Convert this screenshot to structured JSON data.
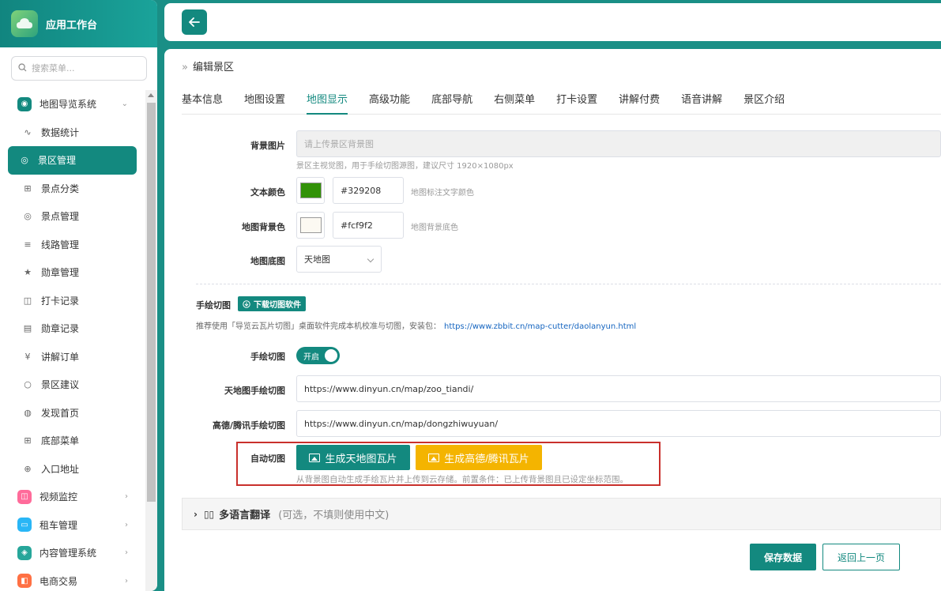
{
  "app": {
    "title": "应用工作台"
  },
  "search": {
    "placeholder": "搜索菜单..."
  },
  "sidebar": {
    "items": [
      {
        "label": "地图导览系统",
        "icon": "map-pin-icon",
        "type": "parent",
        "color": "#13897f",
        "expanded": true
      },
      {
        "label": "数据统计",
        "icon": "pulse-icon",
        "type": "child"
      },
      {
        "label": "景区管理",
        "icon": "location-icon",
        "type": "child",
        "active": true
      },
      {
        "label": "景点分类",
        "icon": "grid-plus-icon",
        "type": "child"
      },
      {
        "label": "景点管理",
        "icon": "location-icon",
        "type": "child"
      },
      {
        "label": "线路管理",
        "icon": "sliders-icon",
        "type": "child"
      },
      {
        "label": "勋章管理",
        "icon": "star-icon",
        "type": "child"
      },
      {
        "label": "打卡记录",
        "icon": "camera-icon",
        "type": "child"
      },
      {
        "label": "勋章记录",
        "icon": "list-icon",
        "type": "child"
      },
      {
        "label": "讲解订单",
        "icon": "yen-icon",
        "type": "child"
      },
      {
        "label": "景区建议",
        "icon": "circle-icon",
        "type": "child"
      },
      {
        "label": "发现首页",
        "icon": "palette-icon",
        "type": "child"
      },
      {
        "label": "底部菜单",
        "icon": "grid-plus-icon",
        "type": "child"
      },
      {
        "label": "入口地址",
        "icon": "globe-icon",
        "type": "child"
      },
      {
        "label": "视频监控",
        "icon": "camera-icon",
        "type": "parent",
        "color": "#ff6b9a"
      },
      {
        "label": "租车管理",
        "icon": "car-icon",
        "type": "parent",
        "color": "#29b6f6"
      },
      {
        "label": "内容管理系统",
        "icon": "layers-icon",
        "type": "parent",
        "color": "#26a69a"
      },
      {
        "label": "电商交易",
        "icon": "cart-icon",
        "type": "parent",
        "color": "#ff7043"
      }
    ]
  },
  "breadcrumb": {
    "current": "编辑景区"
  },
  "tabs": [
    {
      "label": "基本信息"
    },
    {
      "label": "地图设置"
    },
    {
      "label": "地图显示",
      "active": true
    },
    {
      "label": "高级功能"
    },
    {
      "label": "底部导航"
    },
    {
      "label": "右侧菜单"
    },
    {
      "label": "打卡设置"
    },
    {
      "label": "讲解付费"
    },
    {
      "label": "语音讲解"
    },
    {
      "label": "景区介绍"
    }
  ],
  "form": {
    "bg_image": {
      "label": "背景图片",
      "placeholder": "请上传景区背景图",
      "hint": "景区主视觉图，用于手绘切图源图，建议尺寸 1920×1080px"
    },
    "text_color": {
      "label": "文本颜色",
      "value": "#329208",
      "hint": "地图标注文字颜色"
    },
    "map_bg_color": {
      "label": "地图背景色",
      "value": "#fcf9f2",
      "hint": "地图背景底色"
    },
    "base_map": {
      "label": "地图底图",
      "value": "天地图"
    },
    "hand_drawn": {
      "section_label": "手绘切图",
      "download_label": "下载切图软件",
      "note": "推荐使用「导览云瓦片切图」桌面软件完成本机校准与切图，安装包：",
      "link": "https://www.zbbit.cn/map-cutter/daolanyun.html"
    },
    "hand_toggle": {
      "label": "手绘切图",
      "value": "开启"
    },
    "tianditu_url": {
      "label": "天地图手绘切图",
      "value": "https://www.dinyun.cn/map/zoo_tiandi/"
    },
    "gaode_url": {
      "label": "高德/腾讯手绘切图",
      "value": "https://www.dinyun.cn/map/dongzhiwuyuan/"
    },
    "auto_cut": {
      "label": "自动切图",
      "btn_tianditu": "生成天地图瓦片",
      "btn_gaode": "生成高德/腾讯瓦片",
      "hint": "从背景图自动生成手绘瓦片并上传到云存储。前置条件：已上传背景图且已设定坐标范围。"
    }
  },
  "i18n": {
    "title": "多语言翻译",
    "subtitle": "(可选，不填则使用中文)"
  },
  "actions": {
    "save": "保存数据",
    "back": "返回上一页"
  }
}
